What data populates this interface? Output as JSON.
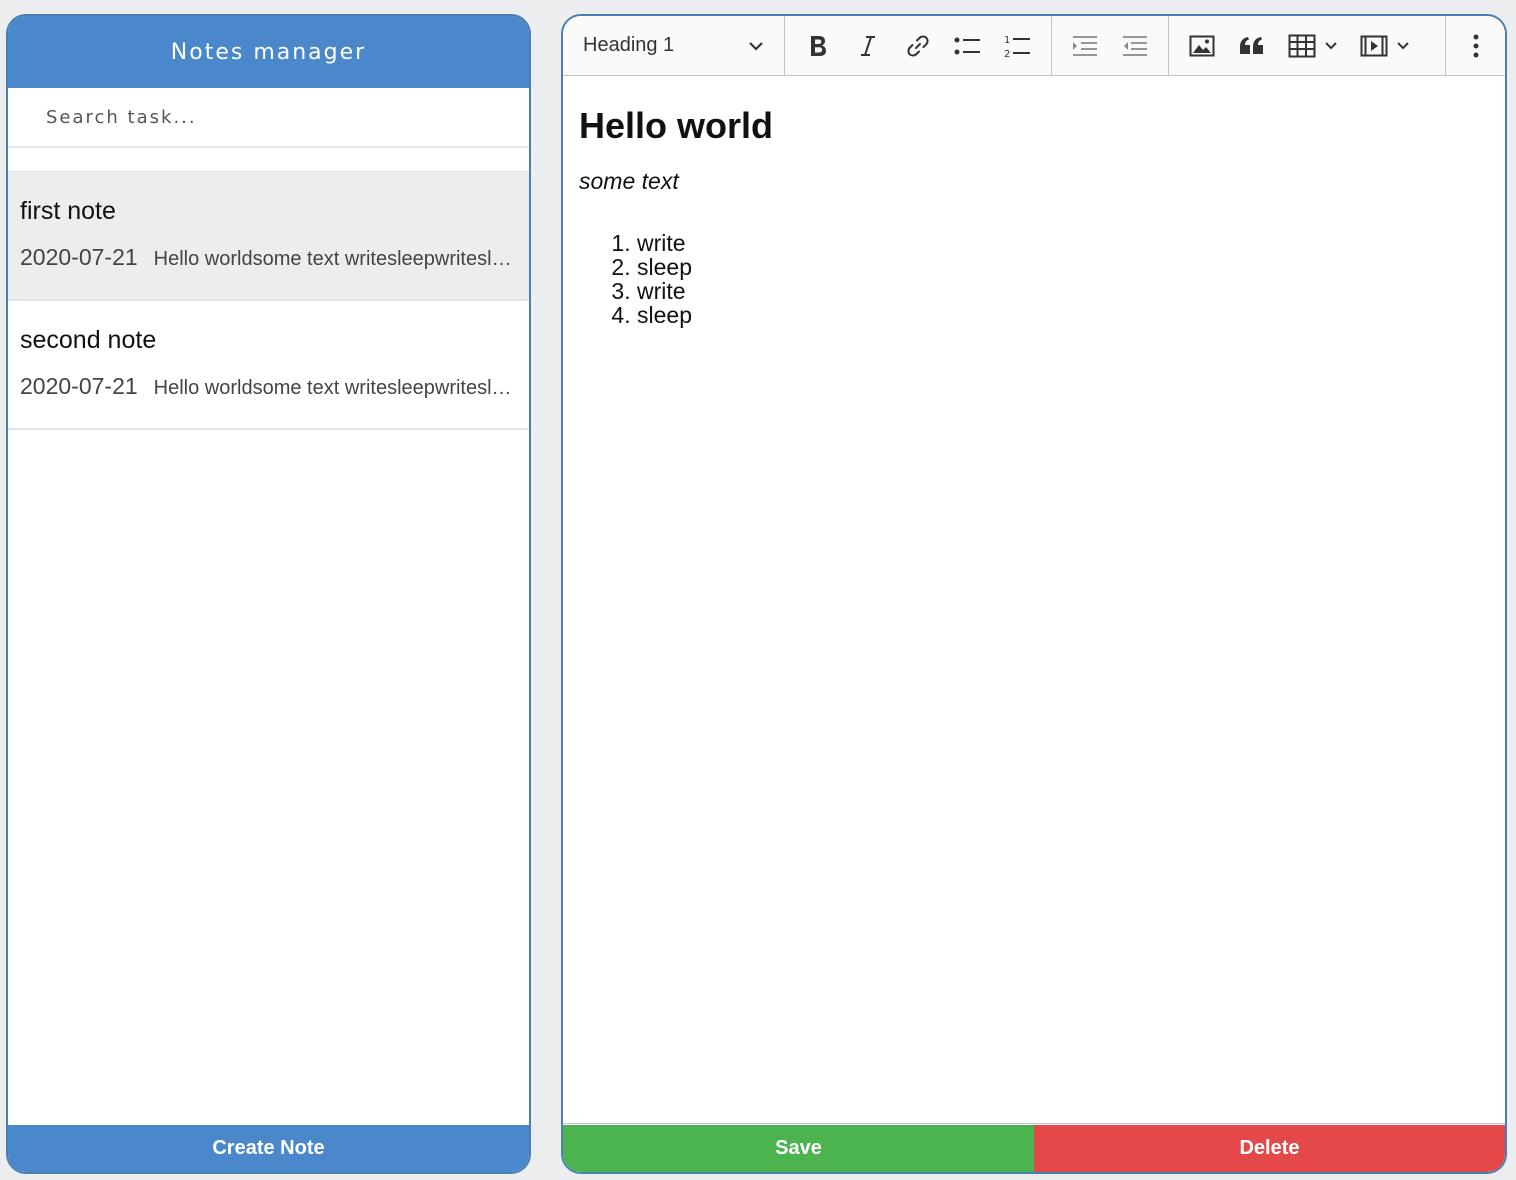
{
  "sidebar": {
    "title": "Notes manager",
    "search": {
      "placeholder": "Search task...",
      "value": ""
    },
    "notes": [
      {
        "title": "first note",
        "date": "2020-07-21",
        "preview": "Hello worldsome text writesleepwritesleep",
        "selected": true
      },
      {
        "title": "second note",
        "date": "2020-07-21",
        "preview": "Hello worldsome text writesleepwritesleep",
        "selected": false
      }
    ],
    "create_label": "Create Note"
  },
  "editor": {
    "toolbar": {
      "heading_value": "Heading 1",
      "icons": [
        "bold-icon",
        "italic-icon",
        "link-icon",
        "bulleted-list-icon",
        "numbered-list-icon",
        "indent-icon",
        "outdent-icon",
        "image-icon",
        "quote-icon",
        "table-icon",
        "media-icon",
        "more-icon"
      ]
    },
    "content": {
      "heading": "Hello world",
      "paragraph": "some text",
      "list": [
        "write",
        "sleep",
        "write",
        "sleep"
      ]
    },
    "save_label": "Save",
    "delete_label": "Delete"
  },
  "colors": {
    "header_blue": "#4a87cb",
    "save_green": "#4bb44f",
    "delete_red": "#e54848",
    "background": "#ecedef"
  }
}
